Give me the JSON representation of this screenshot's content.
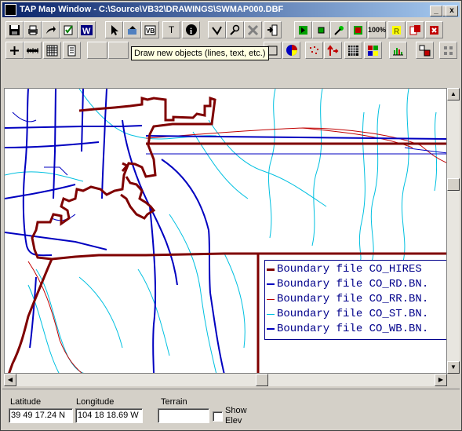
{
  "window": {
    "title": "TAP Map Window - C:\\Source\\VB32\\DRAWINGS\\SWMAP000.DBF",
    "controls": {
      "minimize": "_",
      "maximize": "□",
      "close": "x"
    }
  },
  "tooltip": "Draw new objects (lines, text, etc.)",
  "toolbar1": {
    "text_tool_label": "T",
    "zoom_label": "100%"
  },
  "legend": [
    {
      "label": "Boundary file CO_HIRES",
      "color": "#7f0000"
    },
    {
      "label": "Boundary file CO_RD.BN.",
      "color": "#0000c0"
    },
    {
      "label": "Boundary file CO_RR.BN.",
      "color": "#c00000"
    },
    {
      "label": "Boundary file CO_ST.BN.",
      "color": "#00c0e0"
    },
    {
      "label": "Boundary file CO_WB.BN.",
      "color": "#0000c0"
    }
  ],
  "status": {
    "latitude_label": "Latitude",
    "latitude_value": "39 49 17.24 N",
    "longitude_label": "Longitude",
    "longitude_value": "104 18 18.69 W",
    "terrain_label": "Terrain",
    "terrain_value": "",
    "show_elev_label_1": "Show",
    "show_elev_label_2": "Elev"
  },
  "colors": {
    "boundary": "#7f0000",
    "roads": "#0000c0",
    "railroads": "#c00000",
    "streams": "#00c0e0"
  }
}
